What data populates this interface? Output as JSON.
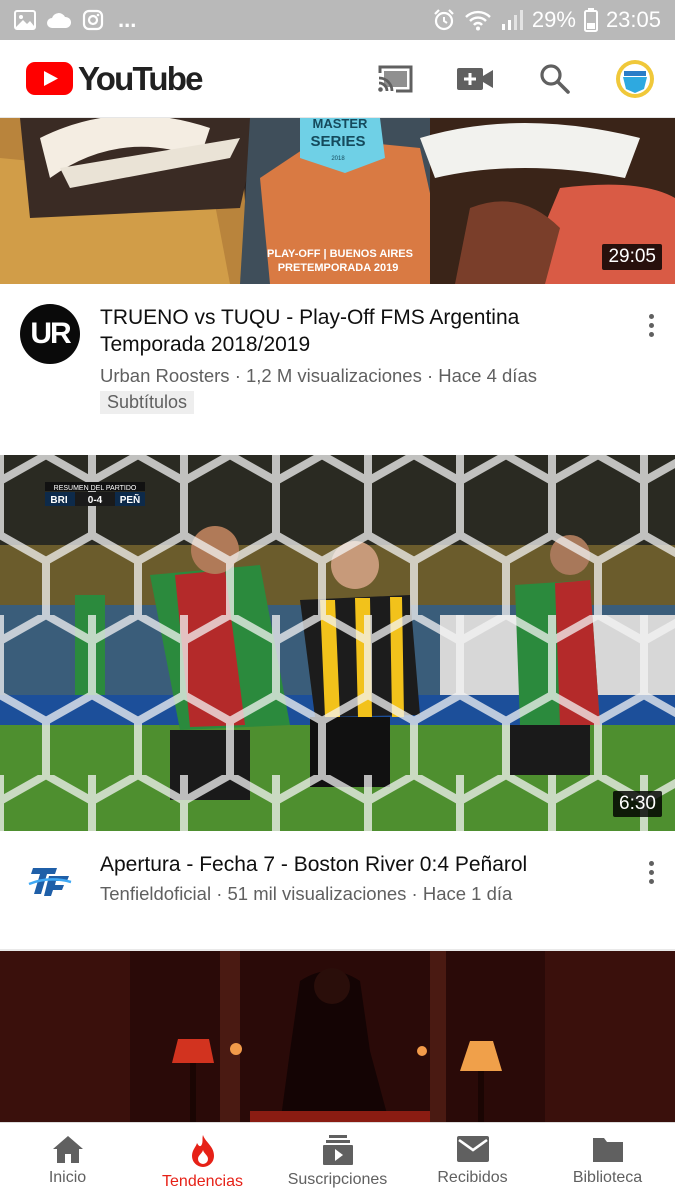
{
  "status_bar": {
    "notifications": [
      "gallery-icon",
      "cloud-icon",
      "instagram-icon"
    ],
    "more": "...",
    "battery": "29%",
    "time": "23:05"
  },
  "app_bar": {
    "logo_text": "YouTube",
    "brand_color": "#ff0000",
    "actions": [
      "cast-icon",
      "upload-video-icon",
      "search-icon",
      "account-avatar"
    ]
  },
  "videos": [
    {
      "thumbnail": {
        "overlay_lines": [
          "PLAY-OFF | BUENOS AIRES",
          "PRETEMPORADA 2019"
        ],
        "badge_text": [
          "MASTER",
          "SERIES",
          "2018"
        ]
      },
      "duration": "29:05",
      "title": "TRUENO vs TUQU - Play-Off FMS Argentina Temporada 2018/2019",
      "channel_avatar_text": "UR",
      "subtitle": "Urban Roosters · 1,2 M visualizaciones · Hace 4 días",
      "badge": "Subtítulos"
    },
    {
      "thumbnail": {
        "scoreboard_caption": "RESUMEN DEL PARTIDO",
        "score": [
          "BRI",
          "0-4",
          "PEÑ"
        ]
      },
      "duration": "6:30",
      "title": "Apertura - Fecha 7 - Boston River 0:4 Peñarol",
      "channel_avatar_text": "TF",
      "subtitle": "Tenfieldoficial · 51 mil visualizaciones · Hace 1 día"
    }
  ],
  "bottom_nav": [
    {
      "label": "Inicio",
      "icon": "home-icon",
      "active": false
    },
    {
      "label": "Tendencias",
      "icon": "trending-flame-icon",
      "active": true
    },
    {
      "label": "Suscripciones",
      "icon": "subscriptions-icon",
      "active": false
    },
    {
      "label": "Recibidos",
      "icon": "inbox-mail-icon",
      "active": false
    },
    {
      "label": "Biblioteca",
      "icon": "library-folder-icon",
      "active": false
    }
  ]
}
